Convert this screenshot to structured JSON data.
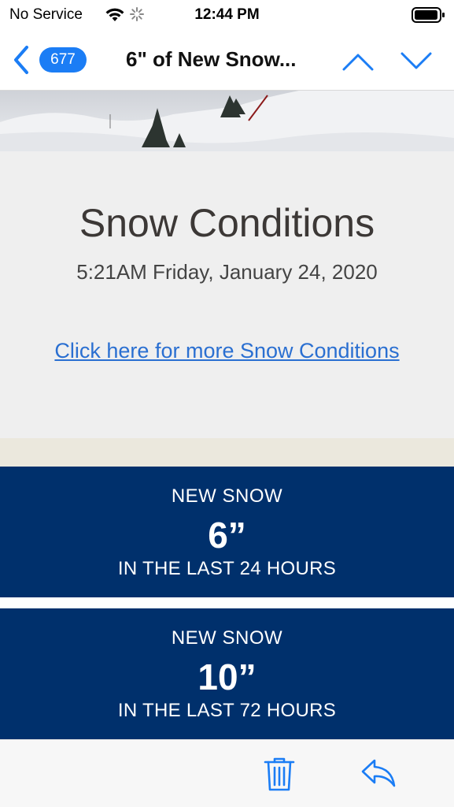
{
  "status_bar": {
    "carrier": "No Service",
    "time": "12:44 PM",
    "icons": [
      "wifi-icon",
      "activity-spinner-icon",
      "battery-icon"
    ]
  },
  "nav": {
    "badge_count": "677",
    "title": "6\" of New Snow...",
    "icons": [
      "back-chevron-icon",
      "chevron-up-icon",
      "chevron-down-icon"
    ],
    "accent_color": "#1b7df5"
  },
  "conditions": {
    "title": "Snow Conditions",
    "datetime": "5:21AM Friday, January 24, 2020",
    "link_text": "Click here for more Snow Conditions"
  },
  "snow_reports": [
    {
      "label": "NEW SNOW",
      "value": "6”",
      "period": "IN THE LAST 24 HOURS"
    },
    {
      "label": "NEW SNOW",
      "value": "10”",
      "period": "IN THE LAST 72 HOURS"
    }
  ],
  "colors": {
    "panel_background": "#00306c",
    "link": "#2a6fd1"
  },
  "toolbar": {
    "icons": [
      "trash-icon",
      "reply-icon"
    ]
  }
}
